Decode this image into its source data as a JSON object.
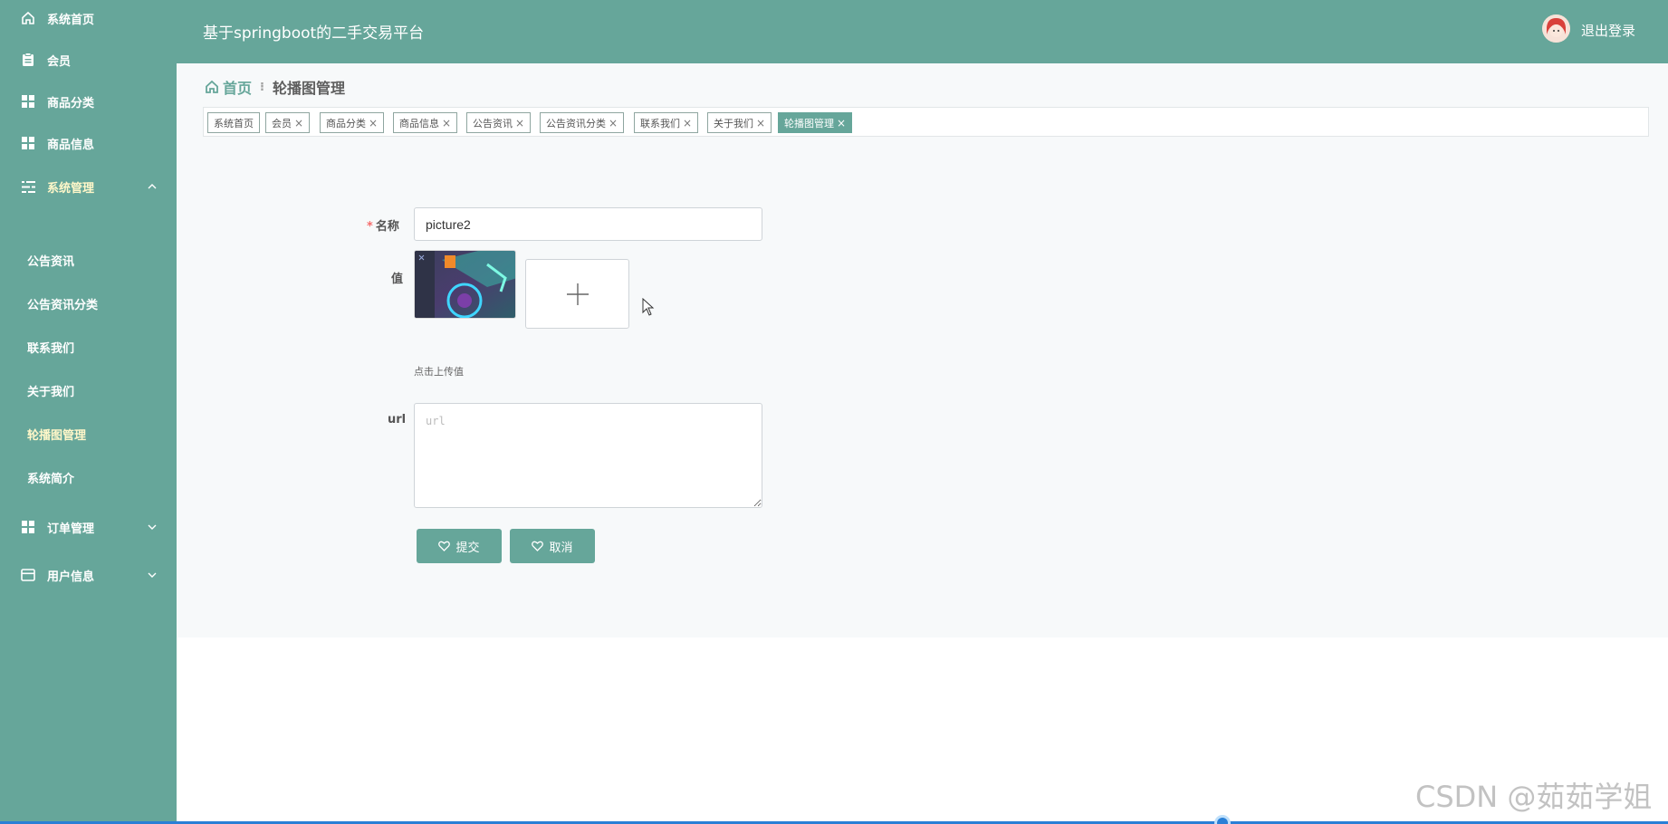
{
  "header": {
    "title": "基于springboot的二手交易平台",
    "logout_label": "退出登录"
  },
  "sidebar": {
    "items": [
      {
        "label": "系统首页",
        "icon": "home-icon"
      },
      {
        "label": "会员",
        "icon": "clipboard-icon"
      },
      {
        "label": "商品分类",
        "icon": "grid-icon"
      },
      {
        "label": "商品信息",
        "icon": "grid-icon"
      },
      {
        "label": "系统管理",
        "icon": "list-icon",
        "expanded": true
      },
      {
        "label": "订单管理",
        "icon": "grid-icon",
        "expanded": false
      },
      {
        "label": "用户信息",
        "icon": "card-icon",
        "expanded": false
      }
    ],
    "sub_items": [
      {
        "label": "公告资讯"
      },
      {
        "label": "公告资讯分类"
      },
      {
        "label": "联系我们"
      },
      {
        "label": "关于我们"
      },
      {
        "label": "轮播图管理",
        "active": true
      },
      {
        "label": "系统简介"
      }
    ]
  },
  "breadcrumb": {
    "home": "首页",
    "current": "轮播图管理"
  },
  "tags": [
    {
      "label": "系统首页",
      "closable": false
    },
    {
      "label": "会员",
      "closable": true
    },
    {
      "label": "商品分类",
      "closable": true
    },
    {
      "label": "商品信息",
      "closable": true
    },
    {
      "label": "公告资讯",
      "closable": true
    },
    {
      "label": "公告资讯分类",
      "closable": true
    },
    {
      "label": "联系我们",
      "closable": true
    },
    {
      "label": "关于我们",
      "closable": true
    },
    {
      "label": "轮播图管理",
      "closable": true,
      "active": true
    }
  ],
  "tag_close_glyph": "×",
  "form": {
    "name_label": "名称",
    "name_value": "picture2",
    "value_label": "值",
    "upload_tip": "点击上传值",
    "url_label": "url",
    "url_placeholder": "url",
    "submit_label": "提交",
    "cancel_label": "取消"
  },
  "watermark": "CSDN @茹茹学姐",
  "colors": {
    "accent": "#66a69a",
    "required": "#f56c6c"
  }
}
